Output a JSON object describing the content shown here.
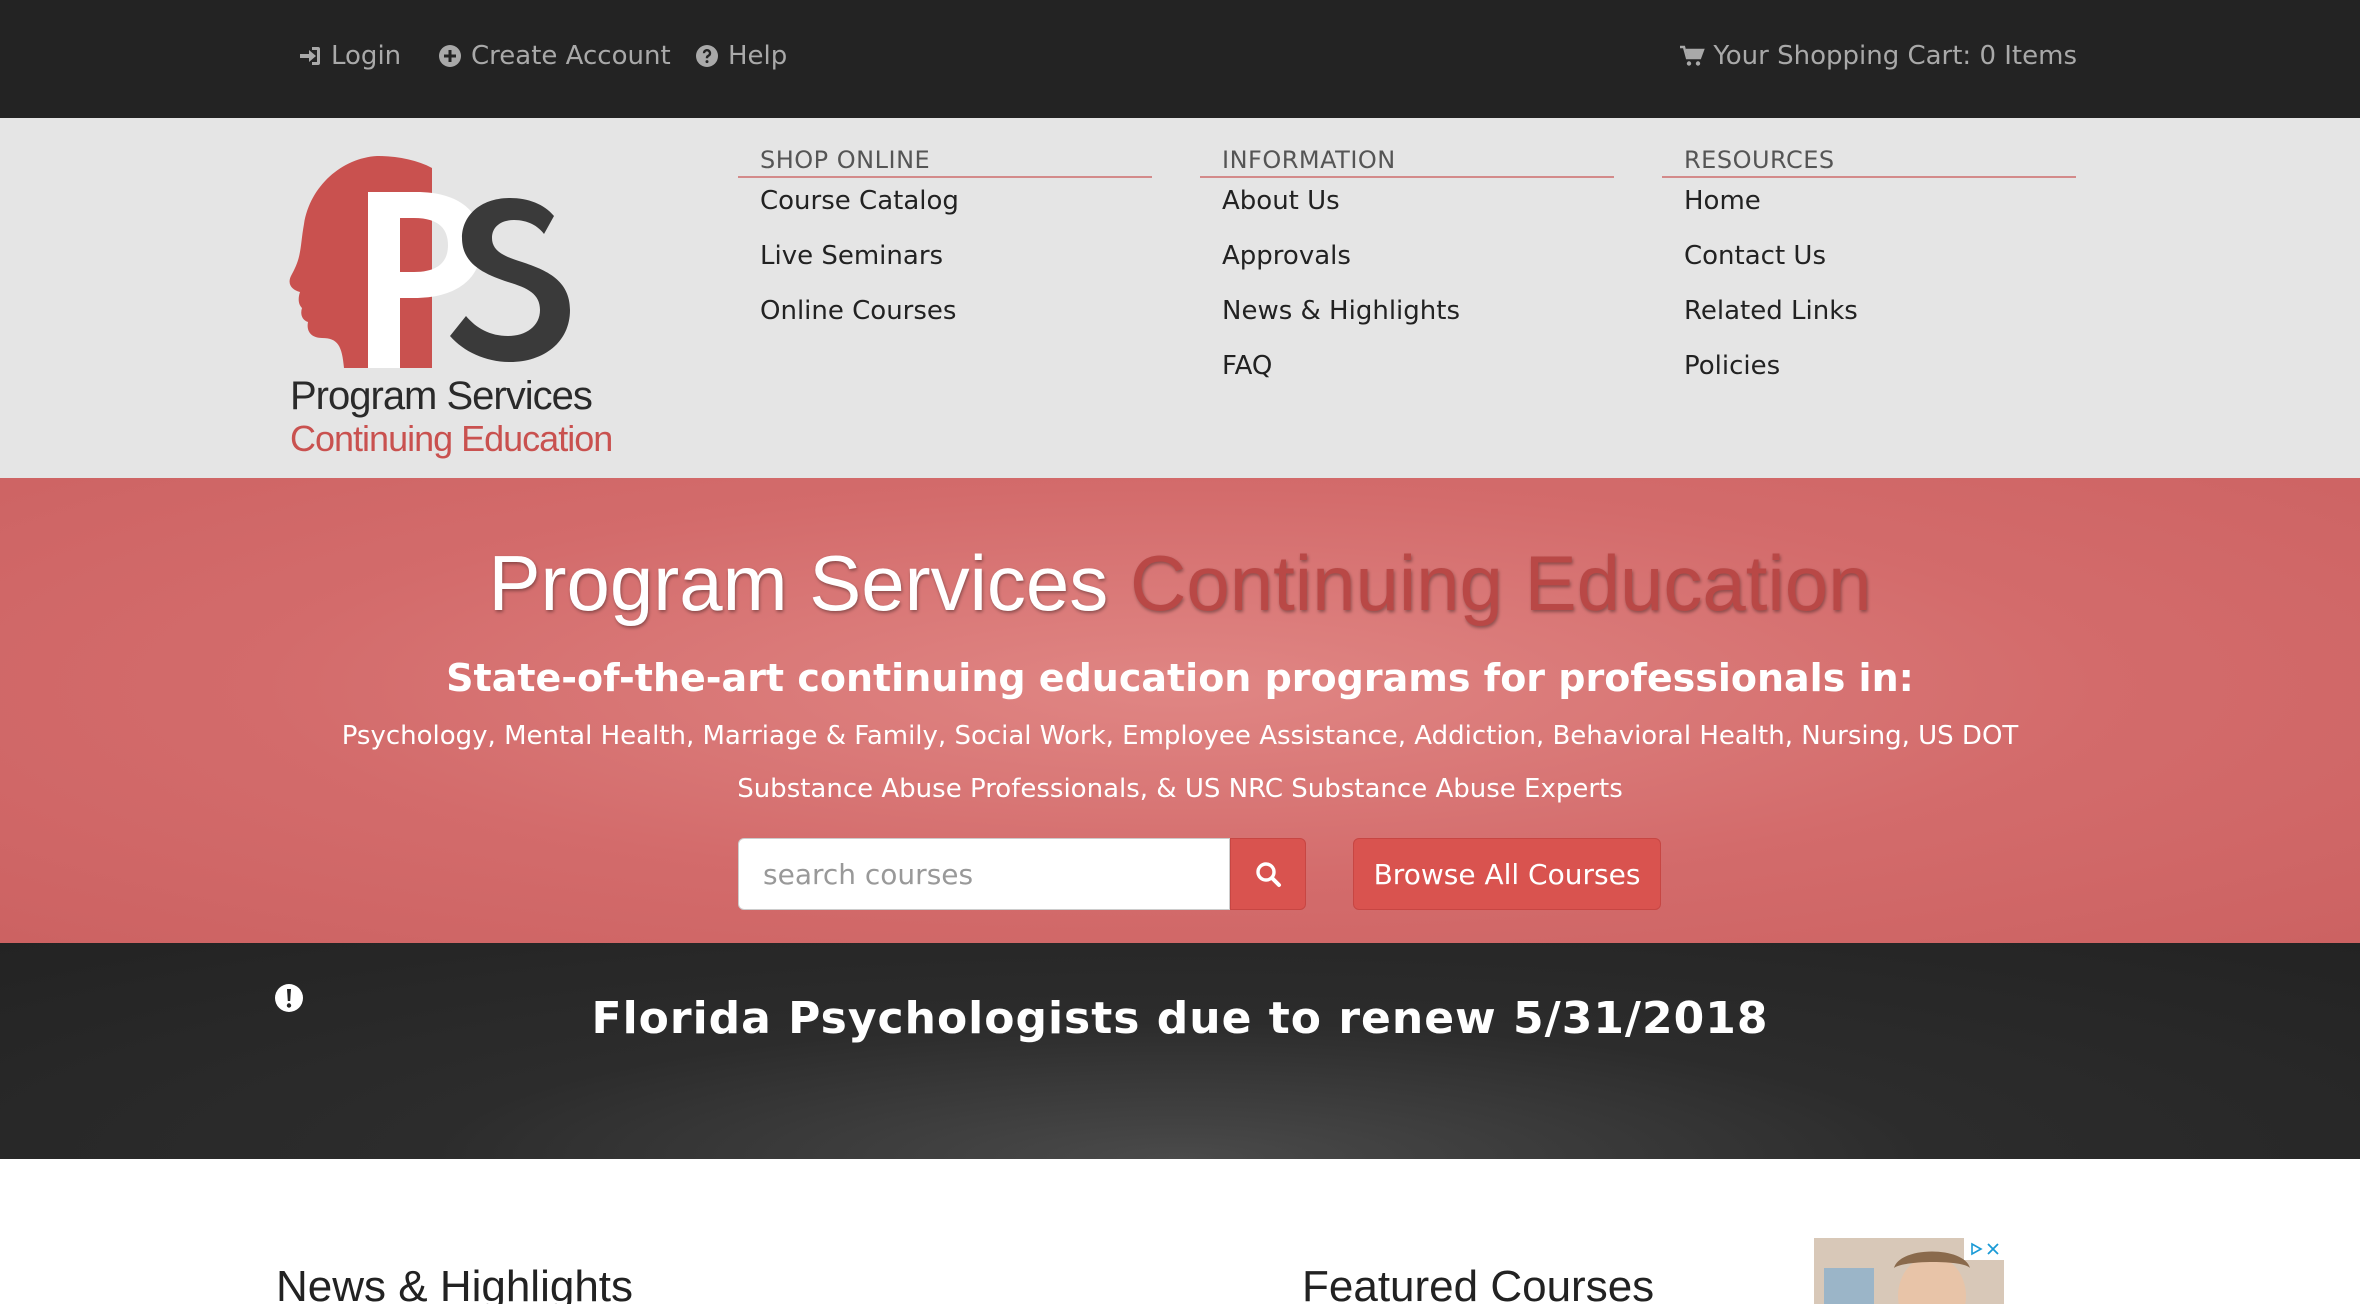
{
  "topbar": {
    "login": "Login",
    "create_account": "Create Account",
    "help": "Help",
    "cart": "Your Shopping Cart: 0 Items",
    "icons": [
      "sign-in-icon",
      "plus-circle-icon",
      "question-circle-icon",
      "shopping-cart-icon"
    ]
  },
  "logo": {
    "monogram": "PS",
    "line1": "Program Services",
    "line2": "Continuing Education"
  },
  "nav": {
    "shop": {
      "heading": "SHOP ONLINE",
      "items": [
        "Course Catalog",
        "Live Seminars",
        "Online Courses"
      ]
    },
    "information": {
      "heading": "INFORMATION",
      "items": [
        "About Us",
        "Approvals",
        "News & Highlights",
        "FAQ"
      ]
    },
    "resources": {
      "heading": "RESOURCES",
      "items": [
        "Home",
        "Contact Us",
        "Related Links",
        "Policies"
      ]
    }
  },
  "hero": {
    "title_white": "Program Services ",
    "title_red": "Continuing Education",
    "subtitle": "State-of-the-art continuing education programs for professionals in:",
    "description": "Psychology, Mental Health, Marriage & Family, Social Work, Employee Assistance, Addiction, Behavioral Health, Nursing, US DOT Substance Abuse Professionals, & US NRC Substance Abuse Experts",
    "search_placeholder": "search courses",
    "browse_button": "Browse All Courses"
  },
  "alert": {
    "text": "Florida Psychologists due to renew 5/31/2018",
    "icon": "exclamation-circle-icon"
  },
  "content": {
    "news_title": "News & Highlights",
    "featured_title": "Featured Courses"
  },
  "colors": {
    "topbar_bg": "#232323",
    "header_bg": "#e5e5e5",
    "accent_red": "#d9534f",
    "hero_bg": "#d36b6b",
    "logo_red": "#c9514f"
  }
}
